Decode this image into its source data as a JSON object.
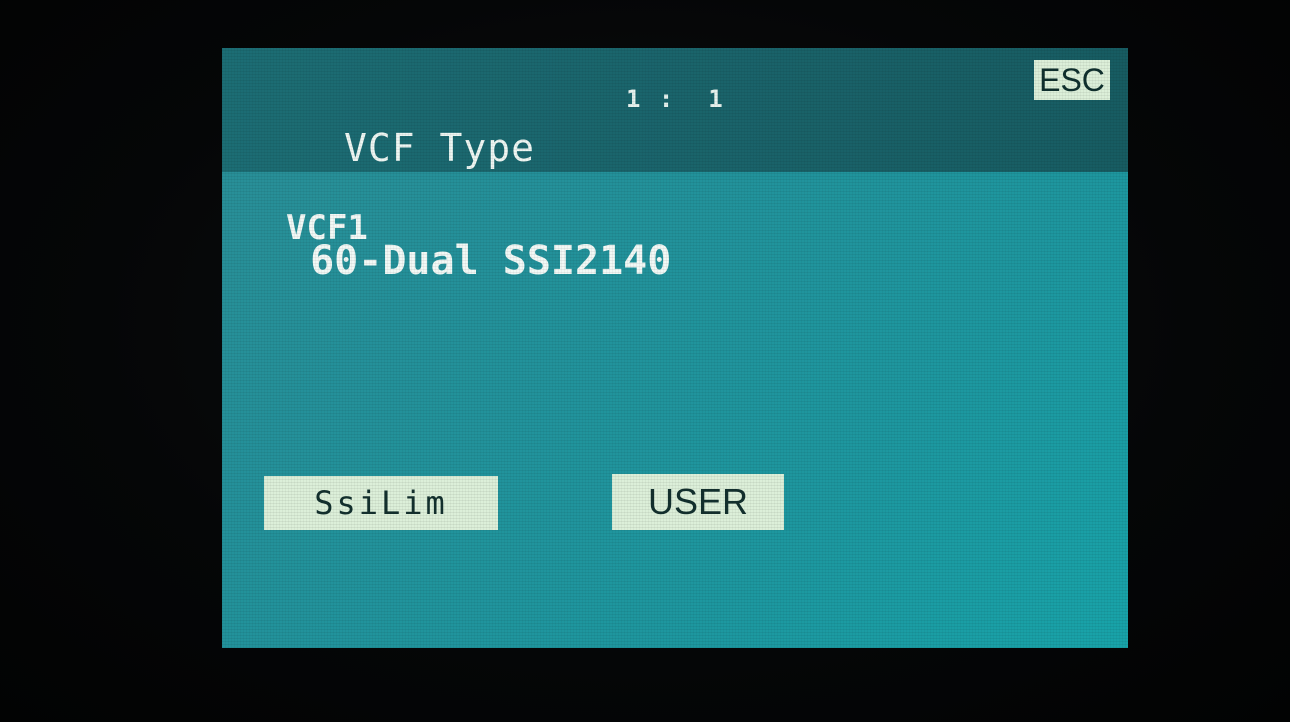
{
  "header": {
    "position": "1 :  1",
    "title": "VCF Type",
    "esc_label": "ESC"
  },
  "parameter": {
    "label": "VCF1",
    "value": " 60-Dual SSI2140"
  },
  "softkeys": [
    {
      "label": "SsiLim"
    },
    {
      "label": "USER"
    }
  ],
  "colors": {
    "screen": "#23919a",
    "header": "#1a646b",
    "button": "#dcefd9",
    "text": "#eef7f3"
  }
}
